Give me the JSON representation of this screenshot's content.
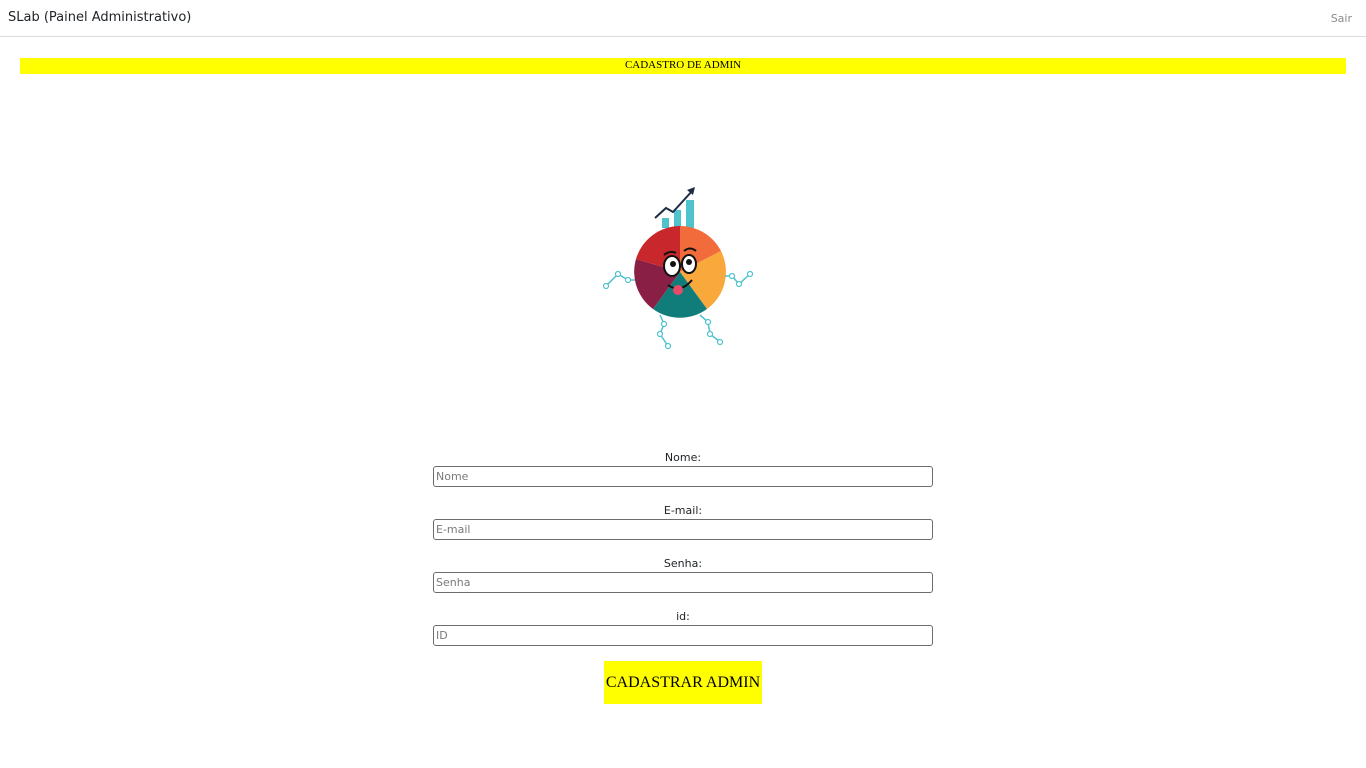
{
  "navbar": {
    "brand": "SLab (Painel Administrativo)",
    "logout": "Sair"
  },
  "banner": {
    "title": "CADASTRO DE ADMIN"
  },
  "form": {
    "fields": [
      {
        "label": "Nome:",
        "placeholder": "Nome"
      },
      {
        "label": "E-mail:",
        "placeholder": "E-mail"
      },
      {
        "label": "Senha:",
        "placeholder": "Senha"
      },
      {
        "label": "id:",
        "placeholder": "ID"
      }
    ],
    "submit_label": "CADASTRAR ADMIN"
  },
  "colors": {
    "accent": "#ffff00",
    "text": "#212529",
    "muted": "#8a8a8a"
  },
  "icons": {
    "mascot": "pie-chart-mascot-icon"
  }
}
